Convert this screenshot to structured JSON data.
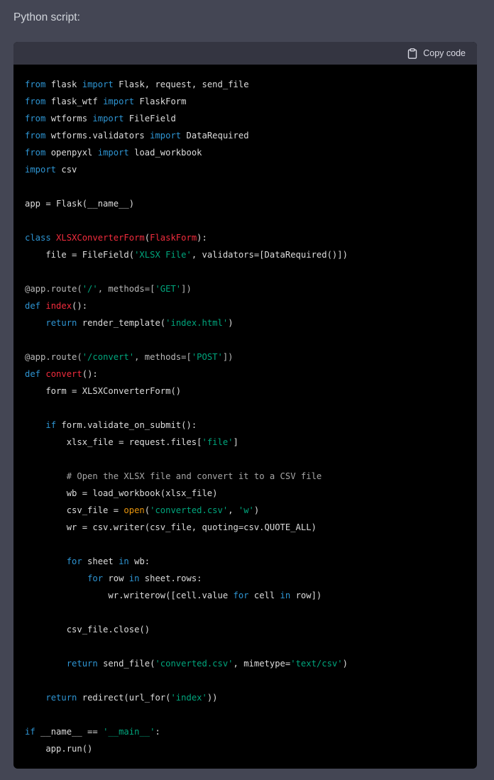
{
  "intro_text": "Python script:",
  "code_block": {
    "copy_label": "Copy code",
    "colors": {
      "keyword": "#2e95d3",
      "class_name": "#f22c3d",
      "string": "#00a67d",
      "builtin": "#e9950c",
      "comment": "#a6a6a6",
      "plain": "#ffffff"
    },
    "lines": [
      [
        [
          "kw",
          "from"
        ],
        [
          "p",
          " flask "
        ],
        [
          "kw",
          "import"
        ],
        [
          "p",
          " Flask, request, send_file"
        ]
      ],
      [
        [
          "kw",
          "from"
        ],
        [
          "p",
          " flask_wtf "
        ],
        [
          "kw",
          "import"
        ],
        [
          "p",
          " FlaskForm"
        ]
      ],
      [
        [
          "kw",
          "from"
        ],
        [
          "p",
          " wtforms "
        ],
        [
          "kw",
          "import"
        ],
        [
          "p",
          " FileField"
        ]
      ],
      [
        [
          "kw",
          "from"
        ],
        [
          "p",
          " wtforms.validators "
        ],
        [
          "kw",
          "import"
        ],
        [
          "p",
          " DataRequired"
        ]
      ],
      [
        [
          "kw",
          "from"
        ],
        [
          "p",
          " openpyxl "
        ],
        [
          "kw",
          "import"
        ],
        [
          "p",
          " load_workbook"
        ]
      ],
      [
        [
          "kw",
          "import"
        ],
        [
          "p",
          " csv"
        ]
      ],
      [],
      [
        [
          "p",
          "app = Flask(__name__)"
        ]
      ],
      [],
      [
        [
          "kw",
          "class"
        ],
        [
          "p",
          " "
        ],
        [
          "cls",
          "XLSXConverterForm"
        ],
        [
          "p",
          "("
        ],
        [
          "cls",
          "FlaskForm"
        ],
        [
          "p",
          "):"
        ]
      ],
      [
        [
          "p",
          "    file = FileField("
        ],
        [
          "str",
          "'XLSX File'"
        ],
        [
          "p",
          ", validators=[DataRequired()])"
        ]
      ],
      [],
      [
        [
          "dec",
          "@app.route("
        ],
        [
          "str",
          "'/'"
        ],
        [
          "dec",
          ", methods=["
        ],
        [
          "str",
          "'GET'"
        ],
        [
          "dec",
          "])"
        ]
      ],
      [
        [
          "kw",
          "def"
        ],
        [
          "p",
          " "
        ],
        [
          "cls",
          "index"
        ],
        [
          "p",
          "():"
        ]
      ],
      [
        [
          "p",
          "    "
        ],
        [
          "kw",
          "return"
        ],
        [
          "p",
          " render_template("
        ],
        [
          "str",
          "'index.html'"
        ],
        [
          "p",
          ")"
        ]
      ],
      [],
      [
        [
          "dec",
          "@app.route("
        ],
        [
          "str",
          "'/convert'"
        ],
        [
          "dec",
          ", methods=["
        ],
        [
          "str",
          "'POST'"
        ],
        [
          "dec",
          "])"
        ]
      ],
      [
        [
          "kw",
          "def"
        ],
        [
          "p",
          " "
        ],
        [
          "cls",
          "convert"
        ],
        [
          "p",
          "():"
        ]
      ],
      [
        [
          "p",
          "    form = XLSXConverterForm()"
        ]
      ],
      [],
      [
        [
          "p",
          "    "
        ],
        [
          "kw",
          "if"
        ],
        [
          "p",
          " form.validate_on_submit():"
        ]
      ],
      [
        [
          "p",
          "        xlsx_file = request.files["
        ],
        [
          "str",
          "'file'"
        ],
        [
          "p",
          "]"
        ]
      ],
      [],
      [
        [
          "p",
          "        "
        ],
        [
          "cm",
          "# Open the XLSX file and convert it to a CSV file"
        ]
      ],
      [
        [
          "p",
          "        wb = load_workbook(xlsx_file)"
        ]
      ],
      [
        [
          "p",
          "        csv_file = "
        ],
        [
          "bi",
          "open"
        ],
        [
          "p",
          "("
        ],
        [
          "str",
          "'converted.csv'"
        ],
        [
          "p",
          ", "
        ],
        [
          "str",
          "'w'"
        ],
        [
          "p",
          ")"
        ]
      ],
      [
        [
          "p",
          "        wr = csv.writer(csv_file, quoting=csv.QUOTE_ALL)"
        ]
      ],
      [],
      [
        [
          "p",
          "        "
        ],
        [
          "kw",
          "for"
        ],
        [
          "p",
          " sheet "
        ],
        [
          "kw",
          "in"
        ],
        [
          "p",
          " wb:"
        ]
      ],
      [
        [
          "p",
          "            "
        ],
        [
          "kw",
          "for"
        ],
        [
          "p",
          " row "
        ],
        [
          "kw",
          "in"
        ],
        [
          "p",
          " sheet.rows:"
        ]
      ],
      [
        [
          "p",
          "                wr.writerow([cell.value "
        ],
        [
          "kw",
          "for"
        ],
        [
          "p",
          " cell "
        ],
        [
          "kw",
          "in"
        ],
        [
          "p",
          " row])"
        ]
      ],
      [],
      [
        [
          "p",
          "        csv_file.close()"
        ]
      ],
      [],
      [
        [
          "p",
          "        "
        ],
        [
          "kw",
          "return"
        ],
        [
          "p",
          " send_file("
        ],
        [
          "str",
          "'converted.csv'"
        ],
        [
          "p",
          ", mimetype="
        ],
        [
          "str",
          "'text/csv'"
        ],
        [
          "p",
          ")"
        ]
      ],
      [],
      [
        [
          "p",
          "    "
        ],
        [
          "kw",
          "return"
        ],
        [
          "p",
          " redirect(url_for("
        ],
        [
          "str",
          "'index'"
        ],
        [
          "p",
          "))"
        ]
      ],
      [],
      [
        [
          "kw",
          "if"
        ],
        [
          "p",
          " __name__ == "
        ],
        [
          "str",
          "'__main__'"
        ],
        [
          "p",
          ":"
        ]
      ],
      [
        [
          "p",
          "    app.run()"
        ]
      ]
    ]
  }
}
